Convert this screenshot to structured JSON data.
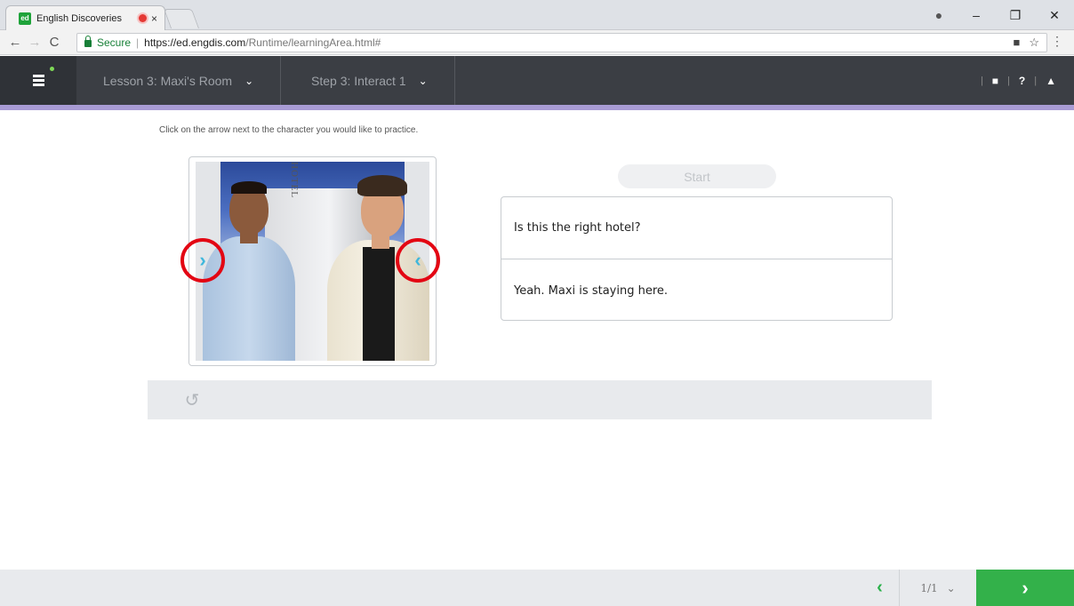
{
  "browser": {
    "tab_title": "English Discoveries",
    "tab_close": "×",
    "favicon_text": "ed",
    "secure_label": "Secure",
    "url_host": "https://ed.engdis.com",
    "url_path": "/Runtime/learningArea.html#",
    "nav_back": "←",
    "nav_forward": "→",
    "nav_reload": "C",
    "win_minimize": "–",
    "win_restore": "❐",
    "win_close": "✕",
    "profile": "●",
    "star": "☆",
    "camera": "■",
    "menu": "⋮"
  },
  "header": {
    "lesson_label": "Lesson 3: Maxi's Room",
    "step_label": "Step 3: Interact 1",
    "chevron": "⌄",
    "book_icon": "■",
    "help_icon": "?",
    "user_icon": "▲",
    "separator": "|"
  },
  "content": {
    "instruction": "Click on the arrow next to the character you would like to practice.",
    "hotel_sign": "HOTEL",
    "arrow_left_glyph": "›",
    "arrow_right_glyph": "‹",
    "start_label": "Start",
    "dialog": [
      "Is this the right hotel?",
      "Yeah. Maxi is staying here."
    ],
    "replay_glyph": "↺"
  },
  "footer": {
    "prev_glyph": "‹",
    "page_indicator": "1/1",
    "page_chevron": "⌄",
    "next_glyph": "›"
  },
  "colors": {
    "header_bg": "#3b3e44",
    "accent_line": "#a89bd4",
    "next_green": "#33b14a",
    "arrow_cyan": "#3fb7dc",
    "highlight_red": "#e30613"
  }
}
